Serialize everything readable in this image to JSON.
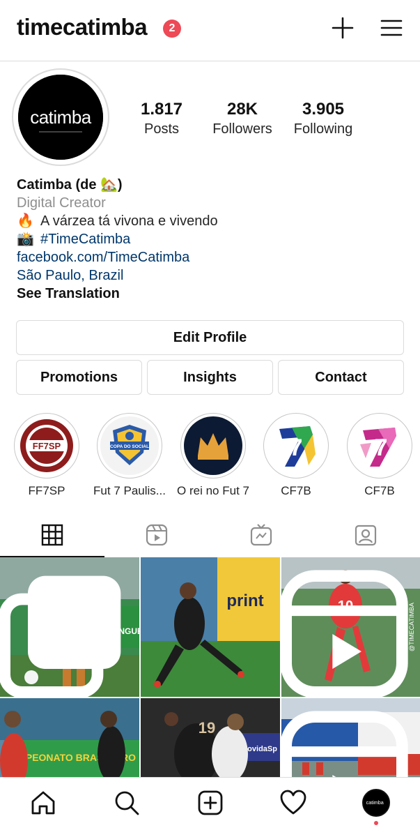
{
  "header": {
    "username": "timecatimba",
    "notification_count": "2",
    "icons": [
      "plus-icon",
      "hamburger-menu-icon"
    ]
  },
  "profile": {
    "avatar_text": "catimba",
    "stats": [
      {
        "value": "1.817",
        "label": "Posts"
      },
      {
        "value": "28K",
        "label": "Followers"
      },
      {
        "value": "3.905",
        "label": "Following"
      }
    ],
    "name": "Catimba (de 🏡)",
    "category": "Digital Creator",
    "bio_line1": "A várzea tá vivona e vivendo",
    "bio_line1_emoji": "🔥",
    "bio_line2": "#TimeCatimba",
    "bio_line2_emoji": "📸",
    "link": "facebook.com/TimeCatimba",
    "location": "São Paulo, Brazil",
    "see_translation": "See Translation"
  },
  "buttons": {
    "edit_profile": "Edit Profile",
    "promotions": "Promotions",
    "insights": "Insights",
    "contact": "Contact"
  },
  "highlights": [
    {
      "label": "FF7SP",
      "badge_text": "FF7SP"
    },
    {
      "label": "Fut 7 Paulis...",
      "badge_text": "COPA DO SOCIAL"
    },
    {
      "label": "O rei no Fut 7"
    },
    {
      "label": "CF7B",
      "badge_text": "7"
    },
    {
      "label": "CF7B",
      "badge_text": "7"
    }
  ],
  "tabs": [
    "grid-icon",
    "reels-icon",
    "igtv-icon",
    "tagged-icon"
  ],
  "grid_posts": [
    {
      "type": "carousel",
      "jersey": "",
      "sign_text": "QUE NINGUÉM"
    },
    {
      "type": "photo",
      "jersey": "",
      "sign_text": "print"
    },
    {
      "type": "reel",
      "jersey": "10",
      "watermark": "@TIMECATIMBA"
    },
    {
      "type": "photo",
      "jersey": "",
      "sign_text": "CAMPEONATO BRASILEIRO"
    },
    {
      "type": "photo",
      "jersey": "19",
      "sign_text": "MovidaSp"
    },
    {
      "type": "reel",
      "jersey": "",
      "sign_text": ""
    }
  ],
  "bottom_nav": [
    "home-icon",
    "search-icon",
    "new-post-icon",
    "activity-heart-icon",
    "profile-avatar"
  ],
  "colors": {
    "badge": "#ed4956",
    "link": "#00376b",
    "muted": "#8e8e8e",
    "border": "#dbdbdb"
  }
}
